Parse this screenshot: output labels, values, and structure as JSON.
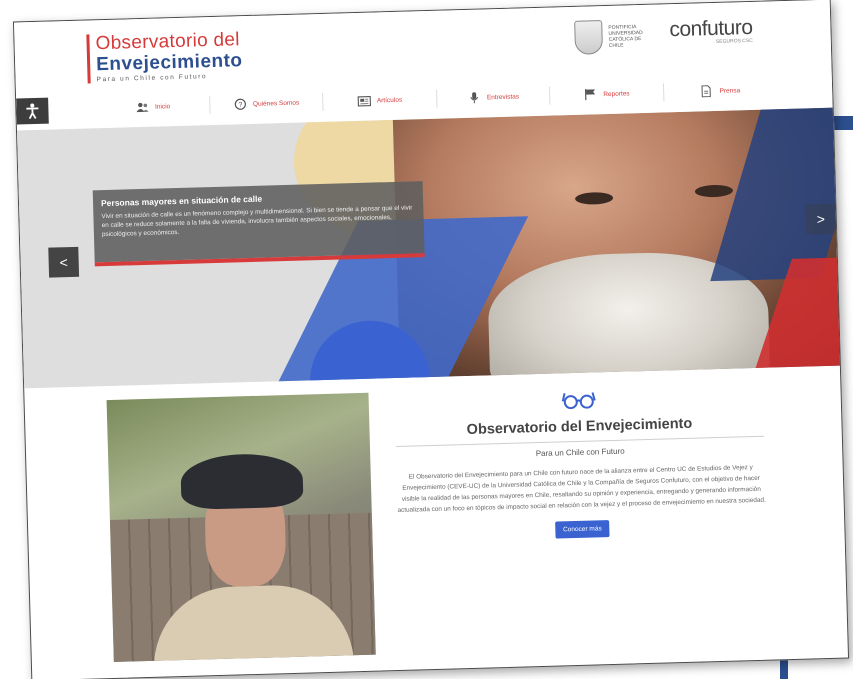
{
  "logo": {
    "line1": "Observatorio del",
    "line2": "Envejecimiento",
    "tagline": "Para un Chile con Futuro"
  },
  "partners": {
    "uc_text": "PONTIFICIA UNIVERSIDAD CATÓLICA DE CHILE",
    "confuturo_name": "confuturo",
    "confuturo_sub": "SEGUROS CSC"
  },
  "nav": {
    "items": [
      {
        "label": "Inicio",
        "icon": "users-icon"
      },
      {
        "label": "Quiénes Somos",
        "icon": "question-icon"
      },
      {
        "label": "Artículos",
        "icon": "newspaper-icon"
      },
      {
        "label": "Entrevistas",
        "icon": "microphone-icon"
      },
      {
        "label": "Reportes",
        "icon": "flag-icon"
      },
      {
        "label": "Prensa",
        "icon": "document-icon"
      }
    ]
  },
  "hero": {
    "title": "Personas mayores en situación de calle",
    "text": "Vivir en situación de calle es un fenómeno complejo y multidimensional. Si bien se tiende a pensar que el vivir en calle se reduce solamente a la falta de vivienda, involucra también aspectos sociales, emocionales, psicológicos y económicos.",
    "prev": "<",
    "next": ">"
  },
  "about": {
    "title": "Observatorio del Envejecimiento",
    "subtitle": "Para un Chile con Futuro",
    "body": "El Observatorio del Envejecimiento para un Chile con futuro nace de la alianza entre el Centro UC de Estudios de Vejez y Envejecimiento (CEVE-UC) de la Universidad Católica de Chile y la Compañía de Seguros Confuturo, con el objetivo de hacer visible la realidad de las personas mayores en Chile, resaltando su opinión y experiencia, entregando y generando información actualizada con un foco en tópicos de impacto social en relación con la vejez y el proceso de envejecimiento en nuestra sociedad.",
    "button": "Conocer más"
  },
  "colors": {
    "red": "#d63a3a",
    "blue": "#3a63d1",
    "navy": "#2c4f8f"
  }
}
